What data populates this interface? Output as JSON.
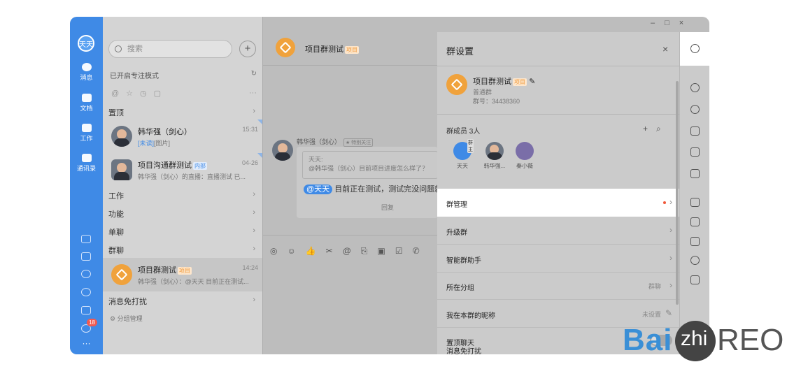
{
  "window_controls": {
    "minimize": "–",
    "maximize": "□",
    "close": "×"
  },
  "rail": {
    "avatar": "天天",
    "items": [
      {
        "label": "消息",
        "icon": "chat-icon"
      },
      {
        "label": "文档",
        "icon": "doc-icon"
      },
      {
        "label": "工作",
        "icon": "apps-icon"
      },
      {
        "label": "通讯录",
        "icon": "contacts-icon"
      }
    ],
    "bottom_badge": "18",
    "more": "···"
  },
  "list": {
    "search_placeholder": "搜索",
    "add": "+",
    "focus_mode": "已开启专注模式",
    "pinned": "置顶",
    "conversations": [
      {
        "name": "韩华强（剑心）",
        "time": "15:31",
        "unread": "[未读]",
        "preview": "[图片]"
      },
      {
        "name": "项目沟通群测试",
        "tag": "内部",
        "time": "04-26",
        "preview": "韩华强（剑心）的直播：直播测试 已..."
      }
    ],
    "sections": [
      "工作",
      "功能",
      "单聊",
      "群聊"
    ],
    "selected": {
      "name": "项目群测试",
      "tag": "项目",
      "time": "14:24",
      "preview": "韩华强（剑心）：@天天 目前正在测试..."
    },
    "dnd": "消息免打扰",
    "group_manage": "分组管理"
  },
  "chat": {
    "title": "项目群测试",
    "title_tag": "项目",
    "sender": "韩华强（剑心）",
    "sender_tag": "★ 特别关注",
    "quote_name": "天天:",
    "quote_text": "@韩华强（剑心）目前项目进度怎么样了？",
    "mention": "@天天",
    "message": "目前正在测试，测试完没问题就能",
    "reply": "回复",
    "toolbar": "◎☺👍✂@⎘▣☑✆"
  },
  "panel": {
    "title": "群设置",
    "close": "×",
    "group_name": "项目群测试",
    "group_tag": "项目",
    "group_type": "普通群",
    "group_id": "群号：34438360",
    "members_label": "群成员 3人",
    "members": [
      {
        "name": "天天",
        "badge": "群主",
        "color": "#3f8ae6"
      },
      {
        "name": "韩华强...",
        "color": "#5a6270"
      },
      {
        "name": "秦小薇",
        "color": "#7a6ea8"
      }
    ],
    "rows": [
      {
        "label": "群管理",
        "value": "",
        "highlight": true
      },
      {
        "label": "升级群",
        "value": ""
      },
      {
        "label": "智能群助手",
        "value": ""
      },
      {
        "label": "所在分组",
        "value": "群聊"
      },
      {
        "label": "我在本群的昵称",
        "value": "未设置"
      },
      {
        "label": "置顶聊天",
        "value": ""
      },
      {
        "label": "消息免打扰",
        "value": ""
      }
    ]
  },
  "watermark": {
    "left": "Bai",
    "mid": "zhi",
    "right": "REO"
  }
}
